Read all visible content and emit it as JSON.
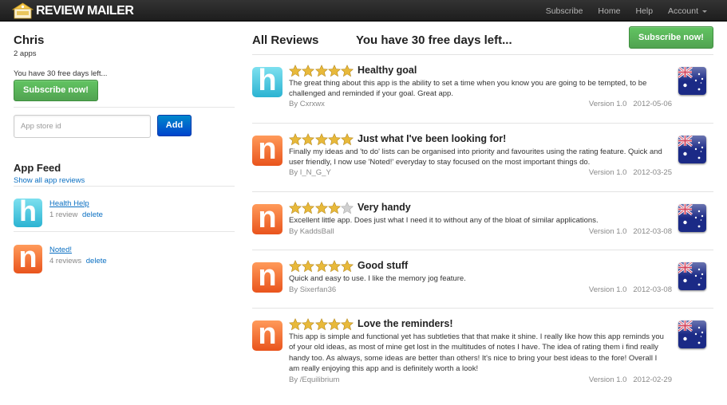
{
  "navbar": {
    "brand": "REVIEW MAILER",
    "links": [
      "Subscribe",
      "Home",
      "Help"
    ],
    "account_label": "Account"
  },
  "sidebar": {
    "user_name": "Chris",
    "apps_count": "2 apps",
    "free_days": "You have 30 free days left...",
    "subscribe_label": "Subscribe now!",
    "app_id_placeholder": "App store id",
    "add_label": "Add",
    "feed_title": "App Feed",
    "show_all_label": "Show all app reviews",
    "feed": [
      {
        "name": "Health Help",
        "reviews": "1 review",
        "delete": "delete",
        "icon": "h"
      },
      {
        "name": "Noted!",
        "reviews": "4 reviews",
        "delete": "delete",
        "icon": "n"
      }
    ]
  },
  "main": {
    "title": "All Reviews",
    "free_days": "You have 30 free days left...",
    "subscribe_label": "Subscribe now!",
    "reviews": [
      {
        "icon": "h",
        "stars": 5,
        "title": "Healthy goal",
        "body": "The great thing about this app is the ability to set a time when you know you are going to be tempted, to be challenged and reminded if your goal. Great app.",
        "author": "By Cxrxwx",
        "version": "Version 1.0",
        "date": "2012-05-06",
        "country_flag": "australia-flag-icon"
      },
      {
        "icon": "n",
        "stars": 5,
        "title": "Just what I've been looking for!",
        "body": "Finally my ideas and 'to do' lists can be organised into priority and favourites using the rating feature. Quick and user friendly, I now use 'Noted!' everyday to stay focused on the most important things do.",
        "author": "By I_N_G_Y",
        "version": "Version 1.0",
        "date": "2012-03-25",
        "country_flag": "australia-flag-icon"
      },
      {
        "icon": "n",
        "stars": 4,
        "title": "Very handy",
        "body": "Excellent little app. Does just what I need it to without any of the bloat of similar applications.",
        "author": "By KaddsBall",
        "version": "Version 1.0",
        "date": "2012-03-08",
        "country_flag": "australia-flag-icon"
      },
      {
        "icon": "n",
        "stars": 5,
        "title": "Good stuff",
        "body": "Quick and easy to use. I like the memory jog feature.",
        "author": "By Sixerfan36",
        "version": "Version 1.0",
        "date": "2012-03-08",
        "country_flag": "australia-flag-icon"
      },
      {
        "icon": "n",
        "stars": 5,
        "title": "Love the reminders!",
        "body": "This app is simple and functional yet has subtleties that that make it shine. I really like how this app reminds you of your old ideas, as most of mine get lost in the multitudes of notes I have. The idea of rating them i find really handy too. As always, some ideas are better than others! It's nice to bring your best ideas to the fore! Overall I am really enjoying this app and is definitely worth a look!",
        "author": "By /Equilibrium",
        "version": "Version 1.0",
        "date": "2012-02-29",
        "country_flag": "australia-flag-icon"
      }
    ]
  },
  "colors": {
    "navbar": "#222222",
    "link": "#0a6fc2",
    "green_button": "#51a351",
    "blue_button": "#0044cc",
    "star_gold": "#e8b93a",
    "star_grey": "#d0d0d0"
  }
}
